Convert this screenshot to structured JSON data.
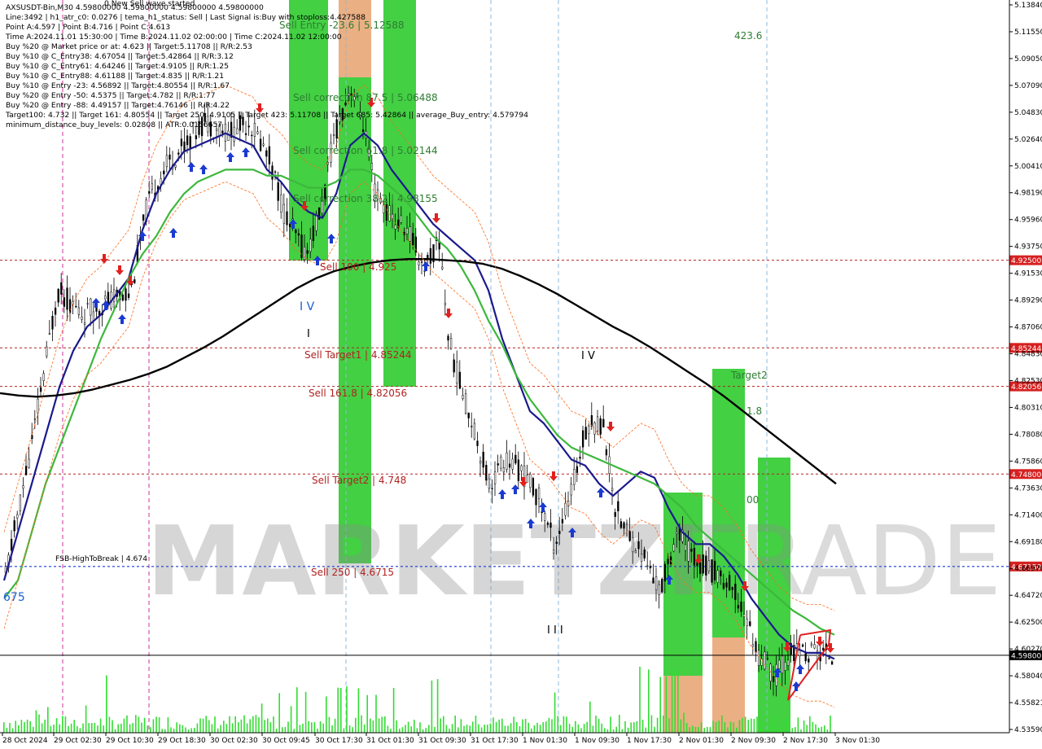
{
  "header": {
    "lines": [
      "AXSUSDT-Bin,M30  4.59800000 4.59800000 4.59800000 4.59800000",
      "Line:3492 | h1_atr_c0: 0.0276 | tema_h1_status: Sell | Last Signal is:Buy with stoploss:4.427588",
      "Point A:4.597 | Point B:4.716 | Point C:4.613",
      "Time A:2024.11.01 15:30:00 | Time B:2024.11.02 02:00:00 | Time C:2024.11.02 12:00:00",
      "Buy %20 @ Market price or at: 4.623 || Target:5.11708 || R/R:2.53",
      "Buy %10 @ C_Entry38: 4.67054 || Target:5.42864 || R/R:3.12",
      "Buy %10 @ C_Entry61: 4.64246 || Target:4.9105 || R/R:1.25",
      "Buy %10 @ C_Entry88: 4.61188 || Target:4.835 || R/R:1.21",
      "Buy %10 @ Entry -23: 4.56892 || Target:4.80554 || R/R:1.67",
      "Buy %20 @ Entry -50: 4.5375 || Target:4.782 || R/R:1.77",
      "Buy %20 @ Entry -88: 4.49157 || Target:4.76146 || R/R:4.22",
      "Target100: 4.732 || Target 161: 4.80554 || Target 250: 4.9105 || Target 423: 5.11708 || Target 685: 5.42864 || average_Buy_entry: 4.579794",
      "minimum_distance_buy_levels: 0.02808 || ATR:0.0156657"
    ],
    "top_status": "0 New Sell wave started"
  },
  "watermark": {
    "left": "MARKETZI",
    "right": "TRADE"
  },
  "chart_data": {
    "type": "candlestick",
    "symbol": "AXSUSDT-Bin",
    "timeframe": "M30",
    "ylim": [
      4.5359,
      5.1384
    ],
    "x_ticks": [
      "28 Oct 2024",
      "29 Oct 02:30",
      "29 Oct 10:30",
      "29 Oct 18:30",
      "30 Oct 02:30",
      "30 Oct 09:45",
      "30 Oct 17:30",
      "31 Oct 01:30",
      "31 Oct 09:30",
      "31 Oct 17:30",
      "1 Nov 01:30",
      "1 Nov 09:30",
      "1 Nov 17:30",
      "2 Nov 01:30",
      "2 Nov 09:30",
      "2 Nov 17:30",
      "3 Nov 01:30"
    ],
    "y_ticks": [
      "5.13840",
      "5.11550",
      "5.09050",
      "5.07090",
      "5.04830",
      "5.02640",
      "5.00410",
      "4.98190",
      "4.95960",
      "4.93750",
      "4.91530",
      "4.89290",
      "4.87060",
      "4.84830",
      "4.82530",
      "4.80310",
      "4.78080",
      "4.75860",
      "4.73630",
      "4.71400",
      "4.69180",
      "4.66970",
      "4.64720",
      "4.62500",
      "4.60270",
      "4.58040",
      "4.55821",
      "4.53590"
    ],
    "levels": [
      {
        "value": 4.925,
        "tag": "4.92500",
        "label": "Sell 100 | 4.925",
        "color": "#b22222"
      },
      {
        "value": 4.85244,
        "tag": "4.85244",
        "label": "Sell Target1 | 4.85244",
        "color": "#b22222"
      },
      {
        "value": 4.82056,
        "tag": "4.82056",
        "label": "Sell 161.8 | 4.82056",
        "color": "#b22222"
      },
      {
        "value": 4.748,
        "tag": "4.74800",
        "label": "Sell Target2 | 4.748",
        "color": "#b22222"
      },
      {
        "value": 4.6715,
        "tag": "4.67150",
        "label": "Sell  250 | 4.6715",
        "color": "#1a3ad1"
      },
      {
        "value": 4.598,
        "tag": "4.59800",
        "label": "",
        "color": "#000000"
      }
    ],
    "fsb_label": "FSB-HighToBreak | 4.674",
    "zone_labels": [
      "Sell Entry -23.6 | 5.12588",
      "Sell correction 87.5 | 5.06488",
      "Sell correction 61.8 | 5.02144",
      "Sell correction 38.2 | 4.98155",
      "423.6",
      "Target2",
      "1.8",
      "00",
      "675"
    ],
    "wave_labels": [
      "I V",
      "I",
      "I V",
      "I I I"
    ],
    "series": [
      {
        "name": "",
        "color": "#1a1a8c",
        "values": [
          4.66,
          4.7,
          4.74,
          4.78,
          4.82,
          4.85,
          4.87,
          4.88,
          4.895,
          4.91,
          4.95,
          4.98,
          5.0,
          5.015,
          5.02,
          5.025,
          5.03,
          5.025,
          5.02,
          5.0,
          4.99,
          4.975,
          4.965,
          4.96,
          4.98,
          5.02,
          5.03,
          5.02,
          5.0,
          4.985,
          4.97,
          4.955,
          4.945,
          4.935,
          4.925,
          4.9,
          4.86,
          4.83,
          4.8,
          4.79,
          4.775,
          4.76,
          4.755,
          4.74,
          4.73,
          4.74,
          4.75,
          4.745,
          4.72,
          4.7,
          4.69,
          4.69,
          4.68,
          4.665,
          4.645,
          4.63,
          4.615,
          4.605,
          4.6,
          4.6,
          4.595
        ]
      },
      {
        "name": "",
        "color": "#3cb83c",
        "values": [
          4.645,
          4.66,
          4.7,
          4.74,
          4.77,
          4.8,
          4.83,
          4.86,
          4.885,
          4.91,
          4.93,
          4.945,
          4.965,
          4.98,
          4.99,
          4.995,
          5.0,
          5.0,
          5.0,
          4.995,
          4.995,
          4.99,
          4.985,
          4.985,
          4.99,
          5.0,
          5.0,
          4.995,
          4.985,
          4.975,
          4.96,
          4.945,
          4.935,
          4.92,
          4.9,
          4.875,
          4.855,
          4.83,
          4.81,
          4.795,
          4.78,
          4.77,
          4.765,
          4.76,
          4.755,
          4.75,
          4.745,
          4.74,
          4.73,
          4.72,
          4.705,
          4.695,
          4.685,
          4.675,
          4.665,
          4.655,
          4.645,
          4.635,
          4.628,
          4.62,
          4.615
        ]
      },
      {
        "name": "",
        "color": "#000000",
        "values": [
          4.815,
          4.813,
          4.812,
          4.813,
          4.815,
          4.818,
          4.822,
          4.826,
          4.831,
          4.837,
          4.845,
          4.853,
          4.862,
          4.872,
          4.882,
          4.892,
          4.902,
          4.91,
          4.916,
          4.92,
          4.923,
          4.925,
          4.926,
          4.926,
          4.925,
          4.924,
          4.922,
          4.918,
          4.912,
          4.905,
          4.897,
          4.888,
          4.879,
          4.87,
          4.862,
          4.853,
          4.843,
          4.833,
          4.823,
          4.812,
          4.8,
          4.788,
          4.776,
          4.764,
          4.752,
          4.74
        ]
      }
    ]
  },
  "colors": {
    "sell_level": "#b22222",
    "buy_arrow": "#1a3ad1",
    "sell_arrow": "#e02020",
    "green_zone": "#33cc33",
    "orange_zone": "#e8a878",
    "volume": "#33dd33"
  }
}
